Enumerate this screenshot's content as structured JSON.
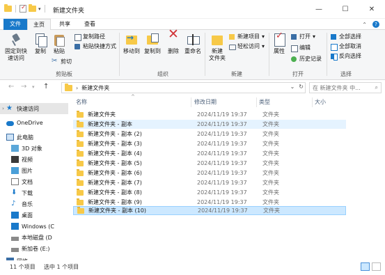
{
  "window": {
    "title": "新建文件夹",
    "min": "—",
    "max": "☐",
    "close": "✕"
  },
  "tabs": [
    "文件",
    "主页",
    "共享",
    "查看"
  ],
  "ribbon": {
    "clipboard": {
      "pin": "固定到快\n速访问",
      "copy": "复制",
      "paste": "粘贴",
      "copy_path": "复制路径",
      "paste_shortcut": "粘贴快捷方式",
      "cut": "剪切",
      "label": "剪贴板"
    },
    "organize": {
      "move_to": "移动到",
      "copy_to": "复制到",
      "delete": "删除",
      "rename": "重命名",
      "label": "组织"
    },
    "new": {
      "new_folder": "新建\n文件夹",
      "new_item": "新建项目",
      "easy_access": "轻松访问",
      "label": "新建"
    },
    "open": {
      "properties": "属性",
      "open": "打开",
      "edit": "编辑",
      "history": "历史记录",
      "label": "打开"
    },
    "select": {
      "select_all": "全部选择",
      "select_none": "全部取消",
      "invert": "反向选择",
      "label": "选择"
    }
  },
  "address": {
    "path": "新建文件夹",
    "search_placeholder": "在 新建文件夹 中..."
  },
  "nav": [
    {
      "label": "快速访问",
      "icon": "star-icon"
    },
    {
      "label": "OneDrive",
      "icon": "cloud-icon"
    },
    {
      "label": "此电脑",
      "icon": "computer-icon"
    },
    {
      "label": "3D 对象",
      "icon": "cube-icon"
    },
    {
      "label": "视频",
      "icon": "video-icon"
    },
    {
      "label": "图片",
      "icon": "picture-icon"
    },
    {
      "label": "文档",
      "icon": "document-icon"
    },
    {
      "label": "下载",
      "icon": "download-icon"
    },
    {
      "label": "音乐",
      "icon": "music-icon"
    },
    {
      "label": "桌面",
      "icon": "desktop-icon"
    },
    {
      "label": "Windows (C",
      "icon": "windows-drive-icon"
    },
    {
      "label": "本地磁盘 (D",
      "icon": "drive-icon"
    },
    {
      "label": "新加卷 (E:)",
      "icon": "drive-icon"
    },
    {
      "label": "网络",
      "icon": "network-icon"
    }
  ],
  "columns": {
    "name": "名称",
    "date": "修改日期",
    "type": "类型",
    "size": "大小"
  },
  "files": [
    {
      "name": "新建文件夹",
      "date": "2024/11/19 19:37",
      "type": "文件夹"
    },
    {
      "name": "新建文件夹 - 副本",
      "date": "2024/11/19 19:37",
      "type": "文件夹"
    },
    {
      "name": "新建文件夹 - 副本 (2)",
      "date": "2024/11/19 19:37",
      "type": "文件夹"
    },
    {
      "name": "新建文件夹 - 副本 (3)",
      "date": "2024/11/19 19:37",
      "type": "文件夹"
    },
    {
      "name": "新建文件夹 - 副本 (4)",
      "date": "2024/11/19 19:37",
      "type": "文件夹"
    },
    {
      "name": "新建文件夹 - 副本 (5)",
      "date": "2024/11/19 19:37",
      "type": "文件夹"
    },
    {
      "name": "新建文件夹 - 副本 (6)",
      "date": "2024/11/19 19:37",
      "type": "文件夹"
    },
    {
      "name": "新建文件夹 - 副本 (7)",
      "date": "2024/11/19 19:37",
      "type": "文件夹"
    },
    {
      "name": "新建文件夹 - 副本 (8)",
      "date": "2024/11/19 19:37",
      "type": "文件夹"
    },
    {
      "name": "新建文件夹 - 副本 (9)",
      "date": "2024/11/19 19:37",
      "type": "文件夹"
    },
    {
      "name": "新建文件夹 - 副本 (10)",
      "date": "2024/11/19 19:37",
      "type": "文件夹"
    }
  ],
  "status": {
    "count": "11 个项目",
    "selected": "选中 1 个项目"
  }
}
